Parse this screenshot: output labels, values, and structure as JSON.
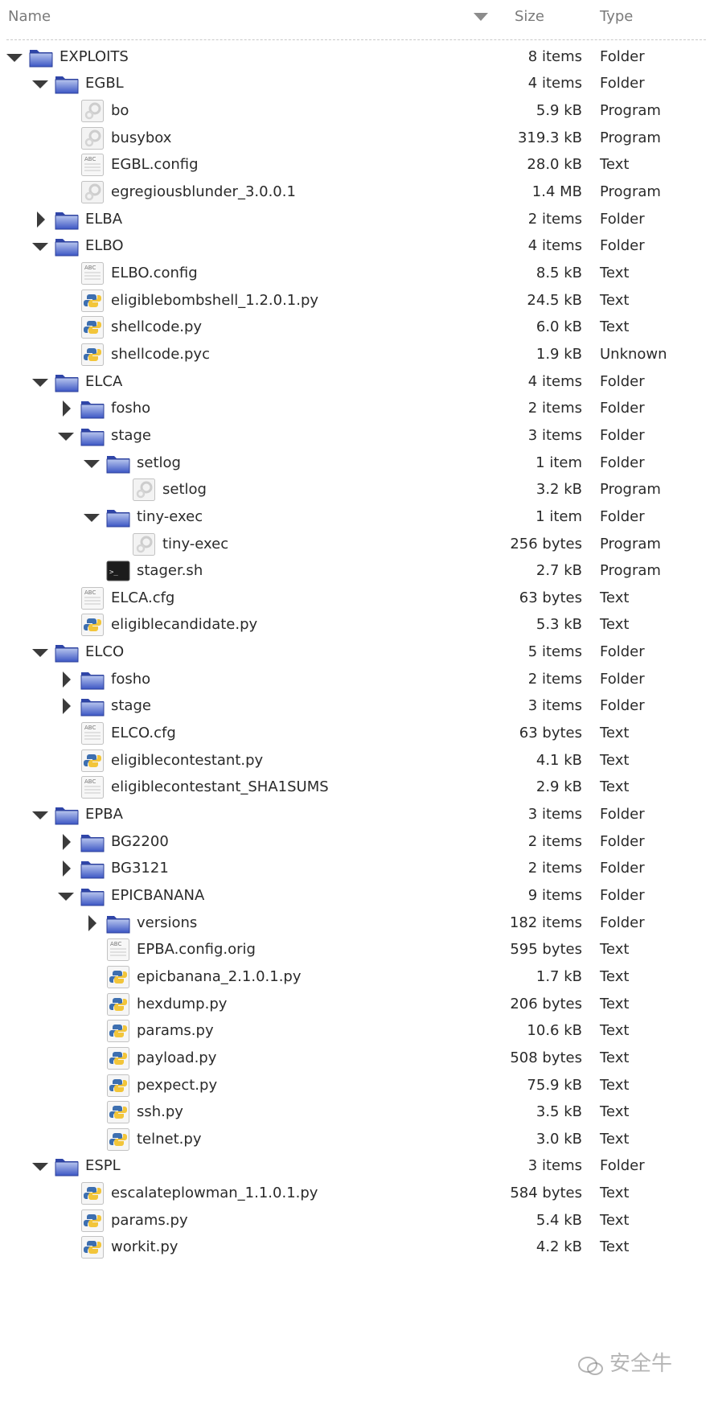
{
  "header": {
    "name": "Name",
    "size": "Size",
    "type": "Type"
  },
  "rows": [
    {
      "level": 0,
      "expander": "open",
      "icon": "folder-icon",
      "name": "EXPLOITS",
      "size": "8 items",
      "type": "Folder"
    },
    {
      "level": 1,
      "expander": "open",
      "icon": "folder-icon",
      "name": "EGBL",
      "size": "4 items",
      "type": "Folder"
    },
    {
      "level": 2,
      "expander": "none",
      "icon": "program-icon",
      "name": "bo",
      "size": "5.9 kB",
      "type": "Program"
    },
    {
      "level": 2,
      "expander": "none",
      "icon": "program-icon",
      "name": "busybox",
      "size": "319.3 kB",
      "type": "Program"
    },
    {
      "level": 2,
      "expander": "none",
      "icon": "text-file-icon",
      "name": "EGBL.config",
      "size": "28.0 kB",
      "type": "Text"
    },
    {
      "level": 2,
      "expander": "none",
      "icon": "program-icon",
      "name": "egregiousblunder_3.0.0.1",
      "size": "1.4 MB",
      "type": "Program"
    },
    {
      "level": 1,
      "expander": "closed",
      "icon": "folder-icon",
      "name": "ELBA",
      "size": "2 items",
      "type": "Folder"
    },
    {
      "level": 1,
      "expander": "open",
      "icon": "folder-icon",
      "name": "ELBO",
      "size": "4 items",
      "type": "Folder"
    },
    {
      "level": 2,
      "expander": "none",
      "icon": "text-file-icon",
      "name": "ELBO.config",
      "size": "8.5 kB",
      "type": "Text"
    },
    {
      "level": 2,
      "expander": "none",
      "icon": "python-file-icon",
      "name": "eligiblebombshell_1.2.0.1.py",
      "size": "24.5 kB",
      "type": "Text"
    },
    {
      "level": 2,
      "expander": "none",
      "icon": "python-file-icon",
      "name": "shellcode.py",
      "size": "6.0 kB",
      "type": "Text"
    },
    {
      "level": 2,
      "expander": "none",
      "icon": "python-file-icon",
      "name": "shellcode.pyc",
      "size": "1.9 kB",
      "type": "Unknown"
    },
    {
      "level": 1,
      "expander": "open",
      "icon": "folder-icon",
      "name": "ELCA",
      "size": "4 items",
      "type": "Folder"
    },
    {
      "level": 2,
      "expander": "closed",
      "icon": "folder-icon",
      "name": "fosho",
      "size": "2 items",
      "type": "Folder"
    },
    {
      "level": 2,
      "expander": "open",
      "icon": "folder-icon",
      "name": "stage",
      "size": "3 items",
      "type": "Folder"
    },
    {
      "level": 3,
      "expander": "open",
      "icon": "folder-icon",
      "name": "setlog",
      "size": "1 item",
      "type": "Folder"
    },
    {
      "level": 4,
      "expander": "none",
      "icon": "program-icon",
      "name": "setlog",
      "size": "3.2 kB",
      "type": "Program"
    },
    {
      "level": 3,
      "expander": "open",
      "icon": "folder-icon",
      "name": "tiny-exec",
      "size": "1 item",
      "type": "Folder"
    },
    {
      "level": 4,
      "expander": "none",
      "icon": "program-icon",
      "name": "tiny-exec",
      "size": "256 bytes",
      "type": "Program"
    },
    {
      "level": 3,
      "expander": "none",
      "icon": "terminal-icon",
      "name": "stager.sh",
      "size": "2.7 kB",
      "type": "Program"
    },
    {
      "level": 2,
      "expander": "none",
      "icon": "text-file-icon",
      "name": "ELCA.cfg",
      "size": "63 bytes",
      "type": "Text"
    },
    {
      "level": 2,
      "expander": "none",
      "icon": "python-file-icon",
      "name": "eligiblecandidate.py",
      "size": "5.3 kB",
      "type": "Text"
    },
    {
      "level": 1,
      "expander": "open",
      "icon": "folder-icon",
      "name": "ELCO",
      "size": "5 items",
      "type": "Folder"
    },
    {
      "level": 2,
      "expander": "closed",
      "icon": "folder-icon",
      "name": "fosho",
      "size": "2 items",
      "type": "Folder"
    },
    {
      "level": 2,
      "expander": "closed",
      "icon": "folder-icon",
      "name": "stage",
      "size": "3 items",
      "type": "Folder"
    },
    {
      "level": 2,
      "expander": "none",
      "icon": "text-file-icon",
      "name": "ELCO.cfg",
      "size": "63 bytes",
      "type": "Text"
    },
    {
      "level": 2,
      "expander": "none",
      "icon": "python-file-icon",
      "name": "eligiblecontestant.py",
      "size": "4.1 kB",
      "type": "Text"
    },
    {
      "level": 2,
      "expander": "none",
      "icon": "text-file-icon",
      "name": "eligiblecontestant_SHA1SUMS",
      "size": "2.9 kB",
      "type": "Text"
    },
    {
      "level": 1,
      "expander": "open",
      "icon": "folder-icon",
      "name": "EPBA",
      "size": "3 items",
      "type": "Folder"
    },
    {
      "level": 2,
      "expander": "closed",
      "icon": "folder-icon",
      "name": "BG2200",
      "size": "2 items",
      "type": "Folder"
    },
    {
      "level": 2,
      "expander": "closed",
      "icon": "folder-icon",
      "name": "BG3121",
      "size": "2 items",
      "type": "Folder"
    },
    {
      "level": 2,
      "expander": "open",
      "icon": "folder-icon",
      "name": "EPICBANANA",
      "size": "9 items",
      "type": "Folder"
    },
    {
      "level": 3,
      "expander": "closed",
      "icon": "folder-icon",
      "name": "versions",
      "size": "182 items",
      "type": "Folder"
    },
    {
      "level": 3,
      "expander": "none",
      "icon": "text-file-icon",
      "name": "EPBA.config.orig",
      "size": "595 bytes",
      "type": "Text"
    },
    {
      "level": 3,
      "expander": "none",
      "icon": "python-file-icon",
      "name": "epicbanana_2.1.0.1.py",
      "size": "1.7 kB",
      "type": "Text"
    },
    {
      "level": 3,
      "expander": "none",
      "icon": "python-file-icon",
      "name": "hexdump.py",
      "size": "206 bytes",
      "type": "Text"
    },
    {
      "level": 3,
      "expander": "none",
      "icon": "python-file-icon",
      "name": "params.py",
      "size": "10.6 kB",
      "type": "Text"
    },
    {
      "level": 3,
      "expander": "none",
      "icon": "python-file-icon",
      "name": "payload.py",
      "size": "508 bytes",
      "type": "Text"
    },
    {
      "level": 3,
      "expander": "none",
      "icon": "python-file-icon",
      "name": "pexpect.py",
      "size": "75.9 kB",
      "type": "Text"
    },
    {
      "level": 3,
      "expander": "none",
      "icon": "python-file-icon",
      "name": "ssh.py",
      "size": "3.5 kB",
      "type": "Text"
    },
    {
      "level": 3,
      "expander": "none",
      "icon": "python-file-icon",
      "name": "telnet.py",
      "size": "3.0 kB",
      "type": "Text"
    },
    {
      "level": 1,
      "expander": "open",
      "icon": "folder-icon",
      "name": "ESPL",
      "size": "3 items",
      "type": "Folder"
    },
    {
      "level": 2,
      "expander": "none",
      "icon": "python-file-icon",
      "name": "escalateplowman_1.1.0.1.py",
      "size": "584 bytes",
      "type": "Text"
    },
    {
      "level": 2,
      "expander": "none",
      "icon": "python-file-icon",
      "name": "params.py",
      "size": "5.4 kB",
      "type": "Text"
    },
    {
      "level": 2,
      "expander": "none",
      "icon": "python-file-icon",
      "name": "workit.py",
      "size": "4.2 kB",
      "type": "Text"
    }
  ],
  "watermark": {
    "text": "安全牛"
  }
}
